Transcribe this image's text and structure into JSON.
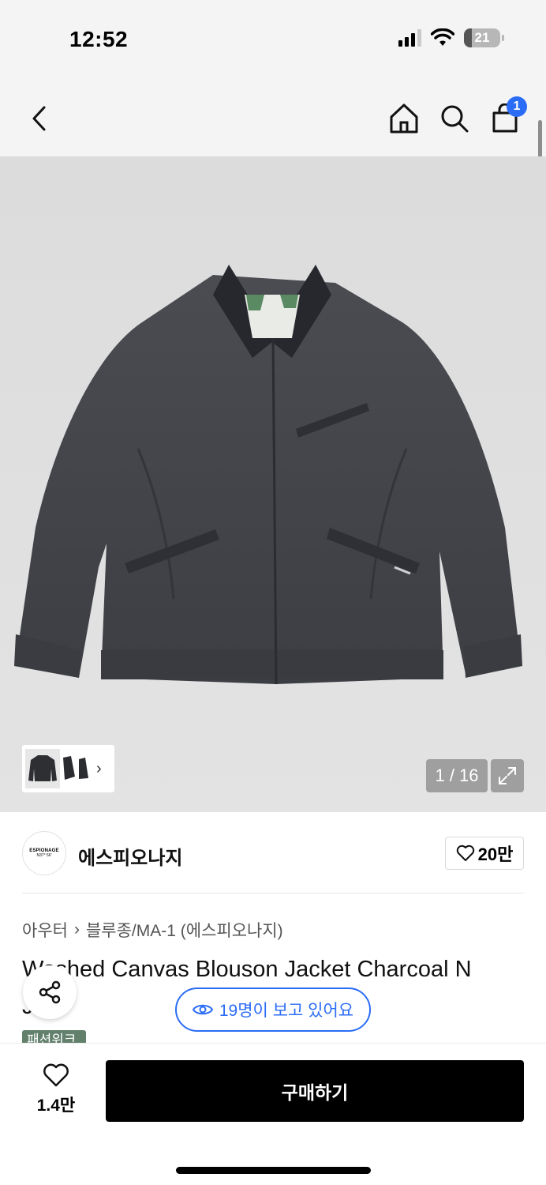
{
  "status_bar": {
    "time": "12:52",
    "battery_level": "21",
    "icons": [
      "signal-icon",
      "wifi-icon",
      "battery-icon"
    ]
  },
  "nav": {
    "back_icon": "chevron-left-icon",
    "home_icon": "home-icon",
    "search_icon": "search-icon",
    "cart_icon": "shopping-bag-icon",
    "cart_badge": "1",
    "badge_color": "#2b6cf6"
  },
  "gallery": {
    "counter": "1 / 16",
    "expand_icon": "expand-icon",
    "thumb_chevron": "›"
  },
  "brand": {
    "logo_main": "ESPIONAGE",
    "logo_sub": "N37° 56'",
    "name": "에스피오나지",
    "like_count": "20만"
  },
  "breadcrumb": {
    "level1": "아우터",
    "separator": "›",
    "level2": "블루종/MA-1 (에스피오나지)"
  },
  "product": {
    "title": "Washed Canvas Blouson Jacket Charcoal N",
    "title_line2": "J",
    "tag": "패션위크"
  },
  "viewers": {
    "text": "19명이 보고 있어요",
    "icon": "eye-icon",
    "color": "#2b6cf6"
  },
  "share": {
    "icon": "share-icon"
  },
  "bottom_bar": {
    "wish_count": "1.4만",
    "wish_icon": "heart-icon",
    "buy_label": "구매하기"
  }
}
